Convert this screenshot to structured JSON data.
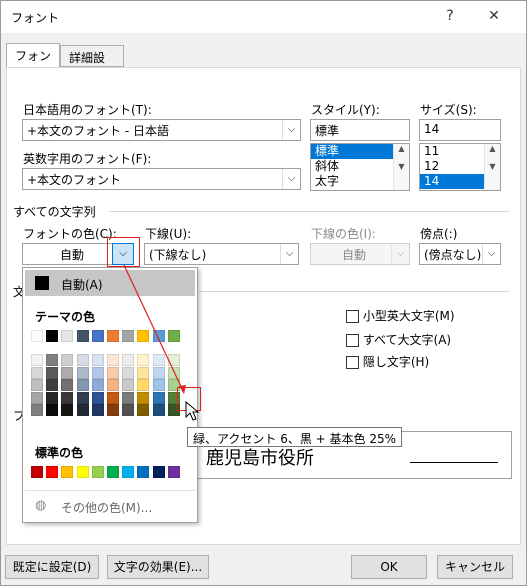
{
  "window": {
    "title": "フォント",
    "help_glyph": "?",
    "close_glyph": "✕"
  },
  "tabs": [
    {
      "label": "フォント"
    },
    {
      "label": "詳細設定"
    }
  ],
  "font": {
    "japanese_label": "日本語用のフォント(T):",
    "japanese_value": "+本文のフォント - 日本語",
    "latin_label": "英数字用のフォント(F):",
    "latin_value": "+本文のフォント",
    "style_label": "スタイル(Y):",
    "style_value": "標準",
    "style_items": [
      "標準",
      "斜体",
      "太字"
    ],
    "size_label": "サイズ(S):",
    "size_value": "14",
    "size_items": [
      "11",
      "12",
      "14"
    ]
  },
  "all_text": {
    "section_label": "すべての文字列",
    "color_label": "フォントの色(C):",
    "color_value": "自動",
    "underline_label": "下線(U):",
    "underline_value": "(下線なし)",
    "underline_color_label": "下線の色(I):",
    "underline_color_value": "自動",
    "emphasis_label": "傍点(:)",
    "emphasis_value": "(傍点なし)"
  },
  "effects": {
    "section_label_partial": "文",
    "small_caps": "小型英大文字(M)",
    "all_caps": "すべて大文字(A)",
    "hidden": "隠し文字(H)"
  },
  "preview": {
    "section_label_partial": "プ",
    "sample": "鹿児島市役所"
  },
  "color_popup": {
    "auto_label": "自動(A)",
    "theme_label": "テーマの色",
    "standard_label": "標準の色",
    "more_label": "その他の色(M)...",
    "theme_top": [
      "#ffffff",
      "#000000",
      "#e7e6e6",
      "#44546a",
      "#4472c4",
      "#ed7d31",
      "#a5a5a5",
      "#ffc000",
      "#5b9bd5",
      "#70ad47"
    ],
    "theme_shades": [
      [
        "#f2f2f2",
        "#808080",
        "#d0cece",
        "#d6dce4",
        "#d9e2f3",
        "#fbe5d5",
        "#ededed",
        "#fff2cc",
        "#deebf6",
        "#e2efd9"
      ],
      [
        "#d8d8d8",
        "#595959",
        "#aeabab",
        "#adb9ca",
        "#b4c6e7",
        "#f7cbac",
        "#dbdbdb",
        "#fee599",
        "#bdd7ee",
        "#c5e0b3"
      ],
      [
        "#bfbfbf",
        "#3f3f3f",
        "#757070",
        "#8496b0",
        "#8eaadb",
        "#f4b183",
        "#c9c9c9",
        "#ffd965",
        "#9dc3e6",
        "#a8d08d"
      ],
      [
        "#a5a5a5",
        "#262626",
        "#3a3838",
        "#323f4f",
        "#2f5496",
        "#c55a11",
        "#7b7b7b",
        "#bf8f00",
        "#2e75b5",
        "#538135"
      ],
      [
        "#7f7f7f",
        "#0c0c0c",
        "#171616",
        "#222a35",
        "#1f3763",
        "#833c0b",
        "#525252",
        "#7f6000",
        "#1e4e79",
        "#375623"
      ]
    ],
    "standard": [
      "#c00000",
      "#ff0000",
      "#ffc000",
      "#ffff00",
      "#92d050",
      "#00b050",
      "#00b0f0",
      "#0070c0",
      "#002060",
      "#7030a0"
    ]
  },
  "tooltip": "緑、アクセント 6、黒 + 基本色 25%",
  "buttons": {
    "set_default": "既定に設定(D)",
    "text_effects": "文字の効果(E)...",
    "ok": "OK",
    "cancel": "キャンセル"
  }
}
